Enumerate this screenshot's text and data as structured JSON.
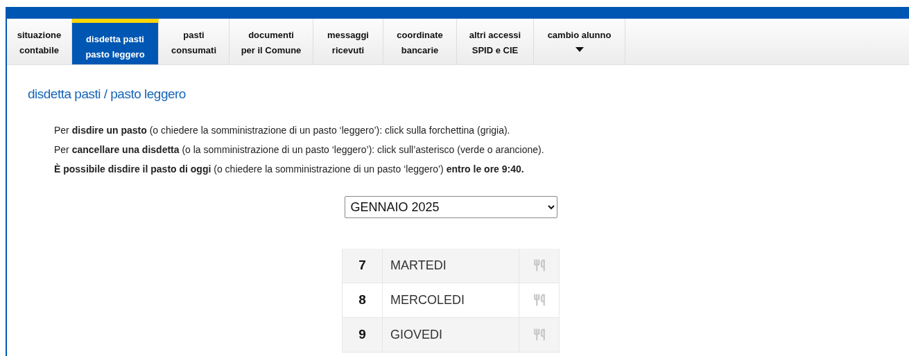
{
  "tabs": [
    {
      "label": "situazione\ncontabile",
      "selected": false
    },
    {
      "label": "disdetta pasti\npasto leggero",
      "selected": true
    },
    {
      "label": "pasti\nconsumati",
      "selected": false
    },
    {
      "label": "documenti\nper il Comune",
      "selected": false
    },
    {
      "label": "messaggi\nricevuti",
      "selected": false
    },
    {
      "label": "coordinate\nbancarie",
      "selected": false
    },
    {
      "label": "altri accessi\nSPID e CIE",
      "selected": false
    },
    {
      "label": "cambio alunno",
      "selected": false,
      "kind": "dropdown"
    }
  ],
  "heading": "disdetta pasti / pasto leggero",
  "instructions": [
    "Per **disdire un pasto** (o chiedere la somministrazione di un pasto ‘leggero’): click sulla forchettina (grigia).",
    "Per **cancellare una disdetta** (o la somministrazione di un pasto ‘leggero’): click sull’asterisco (verde o arancione).",
    "**È possibile disdire il pasto di oggi** (o chiedere la somministrazione di un pasto ‘leggero’) **entro le ore 9:40.**"
  ],
  "month_select": {
    "value": "GENNAIO 2025"
  },
  "days": [
    {
      "day": "7",
      "weekday": "MARTEDI"
    },
    {
      "day": "8",
      "weekday": "MERCOLEDI"
    },
    {
      "day": "9",
      "weekday": "GIOVEDI"
    }
  ]
}
